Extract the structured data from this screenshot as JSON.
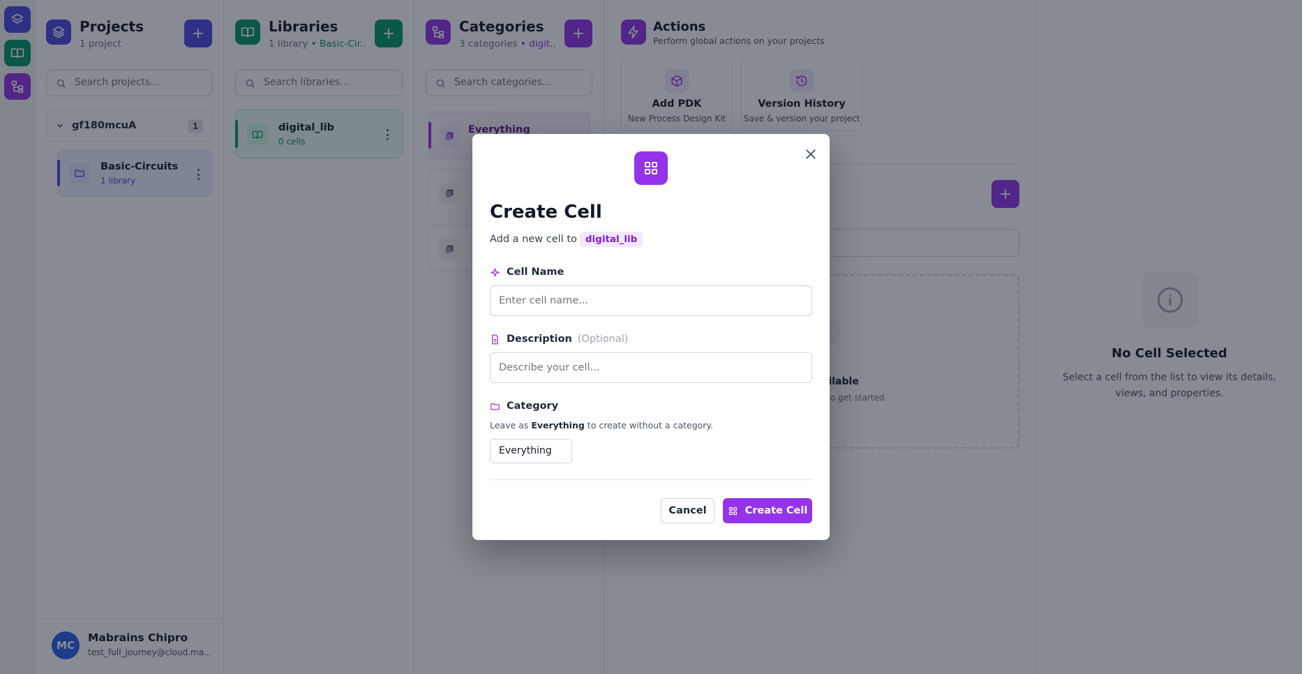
{
  "rail": {
    "icons": [
      "layers-icon",
      "book-icon",
      "hierarchy-icon"
    ]
  },
  "projects": {
    "title": "Projects",
    "subtitle": "1 project",
    "search_placeholder": "Search projects...",
    "group": {
      "name": "gf180mcuA",
      "count": "1"
    },
    "items": [
      {
        "name": "Basic-Circuits",
        "sub": "1 library"
      }
    ]
  },
  "libraries": {
    "title": "Libraries",
    "subtitle": "1 library",
    "subtitle_accent": "• Basic-Cir...",
    "search_placeholder": "Search libraries...",
    "items": [
      {
        "name": "digital_lib",
        "sub": "0 cells"
      }
    ]
  },
  "categories": {
    "title": "Categories",
    "subtitle": "3 categories",
    "subtitle_accent": "• digit...",
    "search_placeholder": "Search categories...",
    "items": [
      {
        "name": "Everything"
      }
    ]
  },
  "actions": {
    "title": "Actions",
    "subtitle": "Perform global actions on your projects",
    "cards": [
      {
        "title": "Add PDK",
        "sub": "New Process Design Kit"
      },
      {
        "title": "Version History",
        "sub": "Save & version your project"
      }
    ],
    "empty_fragment_1": "ailable",
    "empty_fragment_2": "l to get started."
  },
  "details": {
    "title": "No Cell Selected",
    "text": "Select a cell from the list to view its details, views, and properties."
  },
  "user": {
    "initials": "MC",
    "name": "Mabrains Chipro",
    "email": "test_full_journey@cloud.ma..."
  },
  "modal": {
    "title": "Create Cell",
    "subtitle": "Add a new cell to",
    "library_badge": "digital_lib",
    "cell_name_label": "Cell Name",
    "cell_name_placeholder": "Enter cell name...",
    "description_label": "Description",
    "description_optional": "(Optional)",
    "description_placeholder": "Describe your cell...",
    "category_label": "Category",
    "category_hint_pre": "Leave as",
    "category_hint_bold": "Everything",
    "category_hint_post": "to create without a category.",
    "category_value": "Everything",
    "cancel_label": "Cancel",
    "create_label": "Create Cell"
  },
  "colors": {
    "projects": "#4f46e5",
    "libraries": "#059669",
    "categories": "#9333ea",
    "actions": "#9333ea"
  }
}
